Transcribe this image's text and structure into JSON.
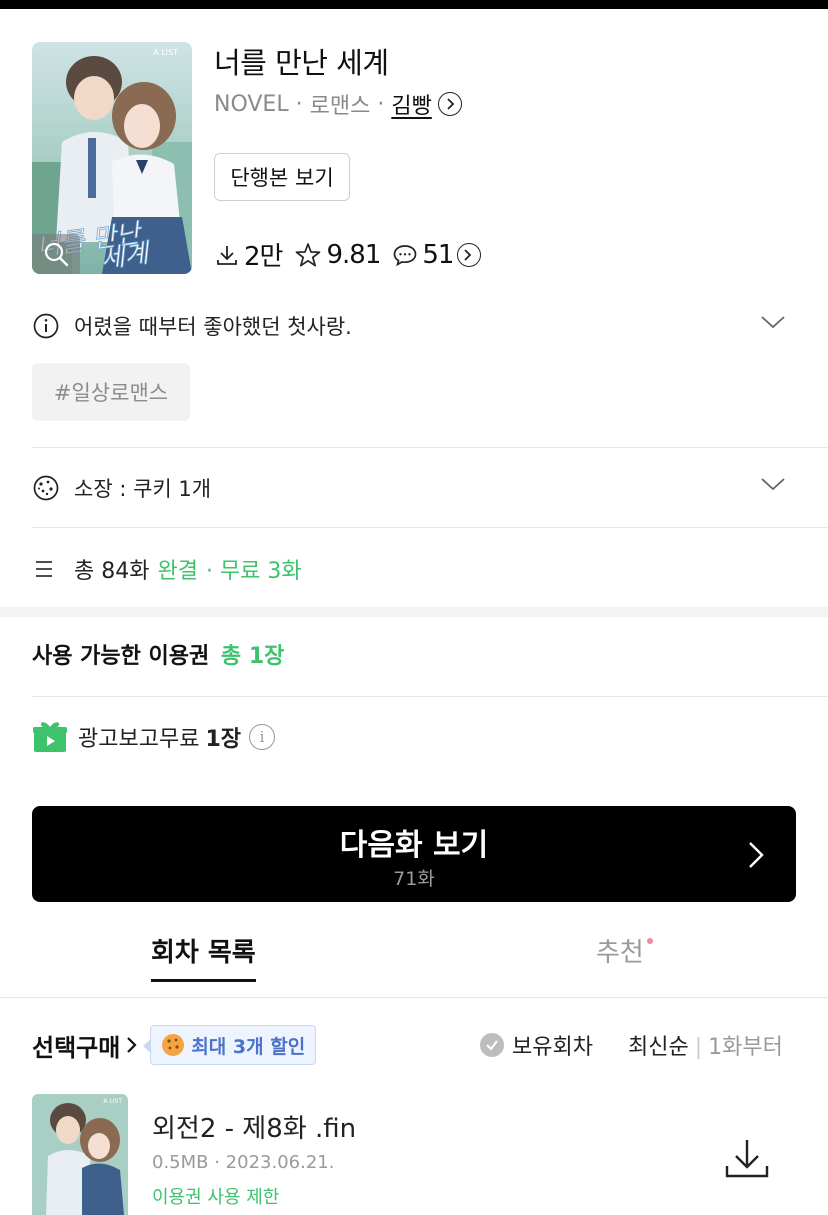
{
  "book": {
    "title": "너를 만난 세계",
    "format": "NOVEL",
    "dot": "·",
    "genre": "로맨스",
    "author": "김빵",
    "cover_label": "A LIST",
    "volume_button": "단행본 보기"
  },
  "stats": {
    "downloads": "2만",
    "rating": "9.81",
    "comments": "51"
  },
  "synopsis": "어렸을 때부터 좋아했던 첫사랑.",
  "tags": [
    "#일상로맨스"
  ],
  "owned": "소장 : 쿠키 1개",
  "episodes_info": {
    "total": "총 84화",
    "status": "완결",
    "free": "· 무료 3화"
  },
  "tickets": {
    "title": "사용 가능한 이용권",
    "total": "총 1장",
    "ad_label": "광고보고무료",
    "ad_count": "1장"
  },
  "next_button": {
    "label": "다음화 보기",
    "episode": "71화"
  },
  "tabs": [
    {
      "label": "회차 목록",
      "active": true
    },
    {
      "label": "추천",
      "active": false
    }
  ],
  "list_header": {
    "select_buy": "선택구매",
    "discount": "최대 3개 할인",
    "owned_filter": "보유회차",
    "sort_newest": "최신순",
    "sort_sep": "|",
    "sort_first": "1화부터"
  },
  "episodes": [
    {
      "title": "외전2 - 제8화 .fin",
      "meta": "0.5MB · 2023.06.21.",
      "limit": "이용권 사용 제한"
    }
  ],
  "colors": {
    "accent_green": "#3ec26c",
    "discount_blue": "#4a73c9",
    "dot_pink": "#f08a9c"
  }
}
